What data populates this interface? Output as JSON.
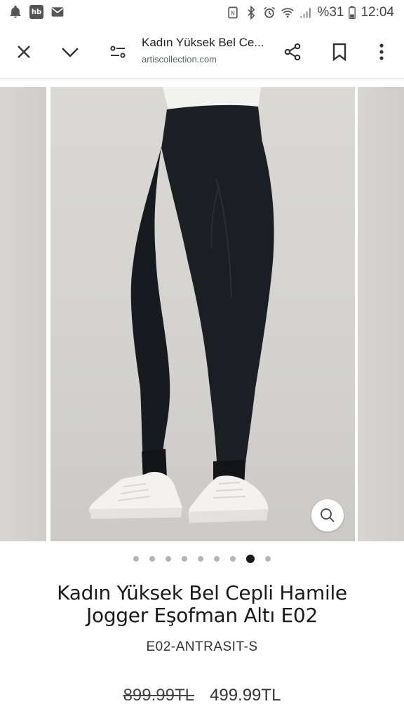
{
  "status_bar": {
    "hb_label": "hb",
    "battery_text": "%31",
    "time": "12:04"
  },
  "toolbar": {
    "title": "Kadın Yüksek Bel Ce...",
    "url": "artiscollection.com",
    "icons": [
      "close-icon",
      "chevron-down-icon",
      "page-settings-icon",
      "share-icon",
      "bookmark-icon",
      "more-vert-icon"
    ]
  },
  "gallery": {
    "image_count": 9,
    "active_index": 7
  },
  "product": {
    "title_line1": "Kadın Yüksek Bel Cepli Hamile",
    "title_line2": "Jogger Eşofman Altı E02",
    "sku": "E02-ANTRASIT-S",
    "old_price": "899.99TL",
    "new_price": "499.99TL"
  }
}
